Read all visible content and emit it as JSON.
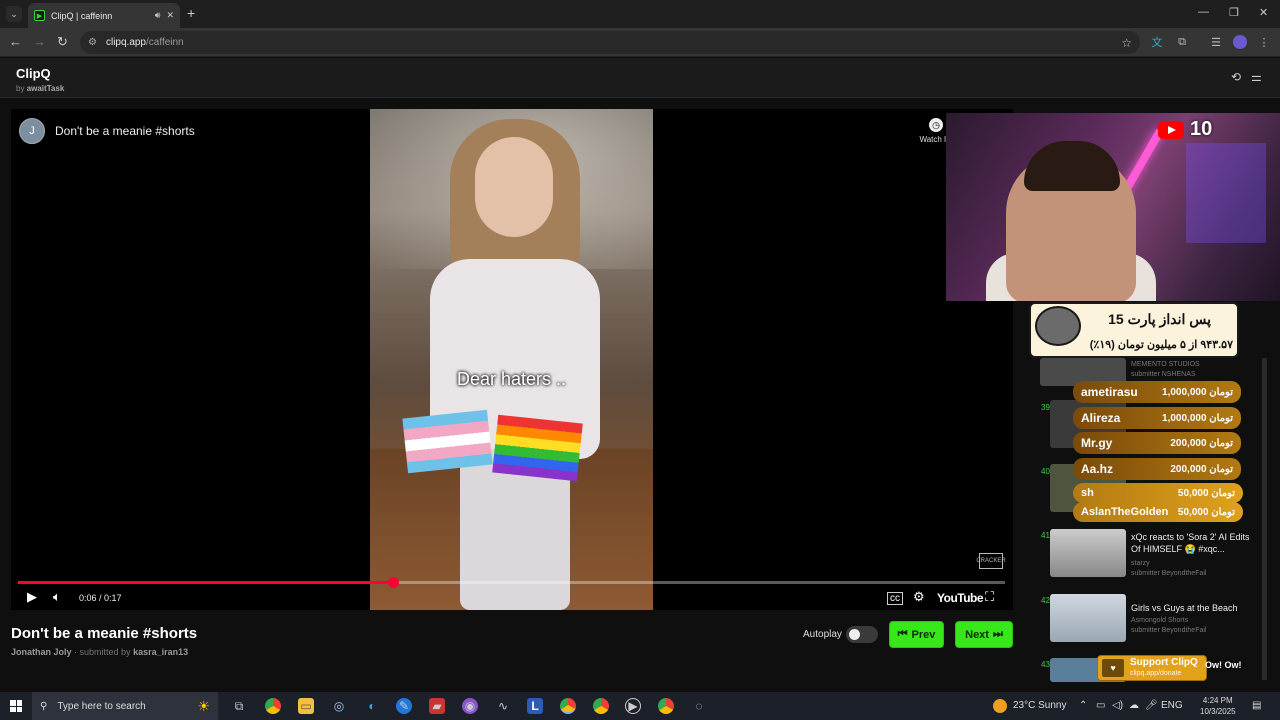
{
  "browser": {
    "tab_title": "ClipQ | caffeinn",
    "tab_favicon": "play-icon",
    "url_host": "clipq.app",
    "url_path": "/caffeinn"
  },
  "app": {
    "brand": "ClipQ",
    "byline_prefix": "by",
    "byline_author": "awaitTask"
  },
  "player": {
    "video_title": "Don't be a meanie #shorts",
    "channel_initial": "J",
    "watch_later": "Watch lat",
    "caption": "Dear haters ..",
    "time_current": "0:06",
    "time_total": "0:17",
    "progress_fraction": 0.38,
    "youtube_label": "YouTube",
    "watermark": "CRACKER"
  },
  "below": {
    "title": "Don't be a meanie #shorts",
    "channel": "Jonathan Joly",
    "submitted_by_label": "submitted by",
    "submitter": "kasra_iran13",
    "autoplay_label": "Autoplay",
    "prev_label": "Prev",
    "next_label": "Next"
  },
  "overlay": {
    "yt_count": "10",
    "goal_title": "پس انداز پارت 15",
    "goal_sub": "۹۴۳.۵۷ از ۵ میلیون تومان (۱۹٪)"
  },
  "queue": [
    {
      "num": "",
      "title": "",
      "channel": "MEMENTO STUDIOS",
      "submitter": "submitter NSHENAS"
    },
    {
      "num": "39",
      "title": "",
      "channel": "",
      "submitter": ""
    },
    {
      "num": "40",
      "title": "",
      "channel": "",
      "submitter": ""
    },
    {
      "num": "41",
      "title": "xQc reacts to 'Sora 2' AI Edits Of HIMSELF 😭 #xqc...",
      "channel": "starzy",
      "submitter": "submitter BeyondtheFail"
    },
    {
      "num": "42",
      "title": "Girls vs Guys at the Beach",
      "channel": "Asmongold Shorts",
      "submitter": "submitter BeyondtheFail"
    },
    {
      "num": "43",
      "title": "",
      "channel": "",
      "submitter": ""
    }
  ],
  "donations": [
    {
      "name": "ametirasu",
      "amount": "1,000,000 تومان",
      "style": "big"
    },
    {
      "name": "Alireza",
      "amount": "1,000,000 تومان",
      "style": "big"
    },
    {
      "name": "Mr.gy",
      "amount": "200,000 تومان",
      "style": "big"
    },
    {
      "name": "Aa.hz",
      "amount": "200,000 تومان",
      "style": "big"
    },
    {
      "name": "sh",
      "amount": "50,000 تومان",
      "style": "small"
    },
    {
      "name": "AslanTheGolden",
      "amount": "50,000 تومان",
      "style": "small"
    }
  ],
  "support": {
    "label": "Support ClipQ",
    "url": "clipq.app/donate",
    "tail_text": "Ow! Ow!"
  },
  "taskbar": {
    "search_placeholder": "Type here to search",
    "weather": "23°C  Sunny",
    "language": "ENG",
    "time": "4:24 PM",
    "date": "10/3/2025"
  },
  "colors": {
    "accent_green": "#37e71a",
    "progress_red": "#ff0033",
    "donation_gold": "#e0a21c"
  }
}
